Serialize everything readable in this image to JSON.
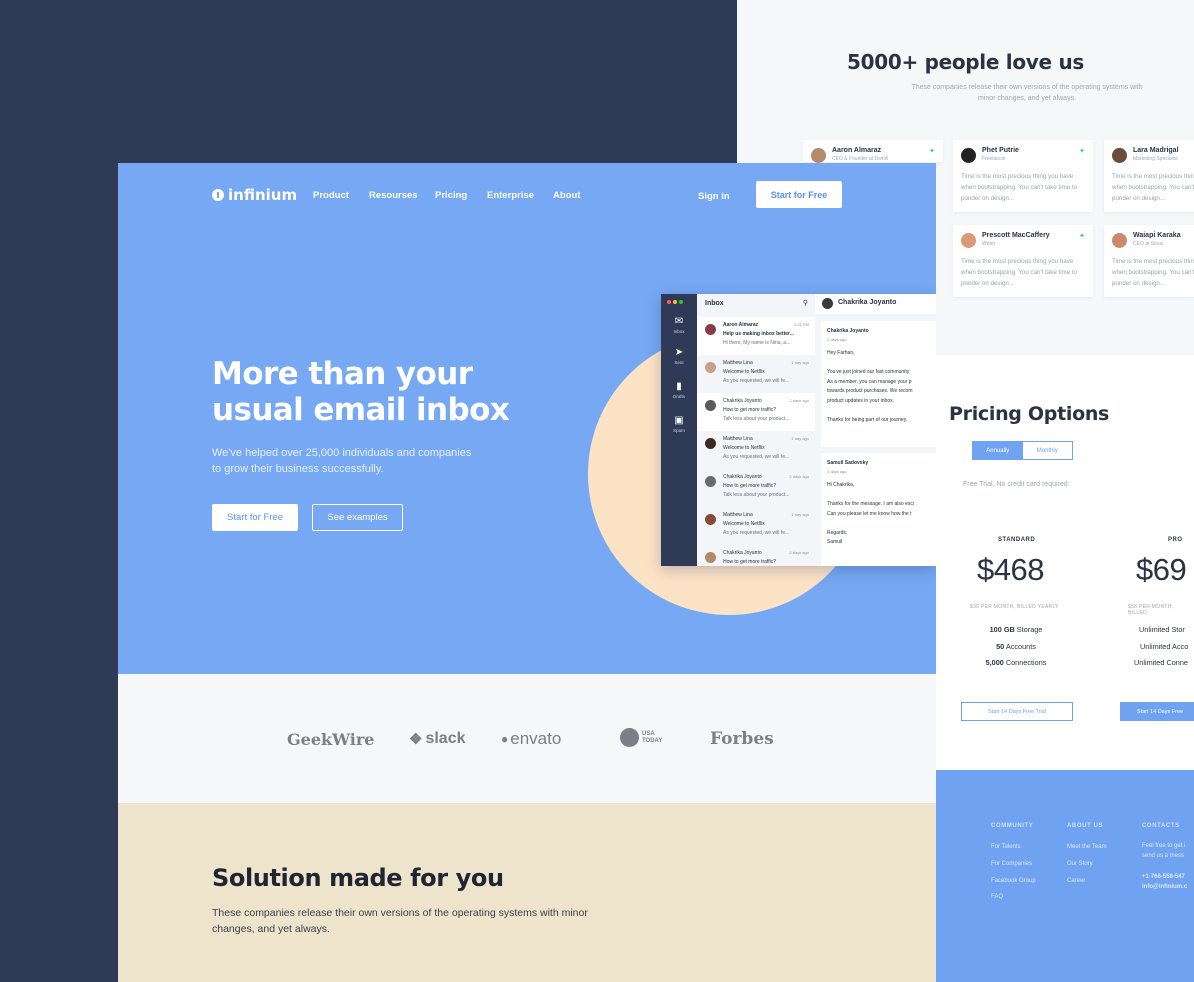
{
  "testimonials": {
    "title": "5000+ people love us",
    "subtitle": "These companies release their own versions of the operating systems with minor changes, and yet always.",
    "cards": [
      {
        "name": "Aaron Almaraz",
        "role": "CEO & Founder at Dwroll",
        "text": ""
      },
      {
        "name": "Phet Putrie",
        "role": "Freelancer",
        "text": "Time is the most precious thing you have when bootstrapping. You can't take time to ponder on design..."
      },
      {
        "name": "Lara Madrigal",
        "role": "Marketing Specialist",
        "text": "Time is the most precious thing you have when bootstrapping. You can't take time to ponder on design..."
      },
      {
        "name": "Prescott MacCaffery",
        "role": "Writer",
        "text": "Time is the most precious thing you have when bootstrapping. You can't take time to ponder on design..."
      },
      {
        "name": "Waiapi Karaka",
        "role": "CEO at Sinus",
        "text": "Time is the most precious thing you have when bootstrapping. You can't take time to ponder on design..."
      }
    ]
  },
  "pricing": {
    "title": "Pricing Options",
    "toggle": {
      "annually": "Annually",
      "monthly": "Monthly"
    },
    "note": "Free Trial. No credit card required.",
    "plans": [
      {
        "name": "STANDARD",
        "price": "$468",
        "billing": "$39 PER MONTH, BILLED YEARLY",
        "features": [
          {
            "b": "100 GB",
            "t": " Storage"
          },
          {
            "b": "50",
            "t": " Accounts"
          },
          {
            "b": "5,000",
            "t": " Connections"
          }
        ],
        "cta": "Start 14 Days Free Trial"
      },
      {
        "name": "PRO",
        "price": "$69",
        "billing": "$58 PER MONTH, BILLED",
        "features": [
          {
            "b": "",
            "t": "Unlimited Stor"
          },
          {
            "b": "",
            "t": "Unlimited Acco"
          },
          {
            "b": "",
            "t": "Unlimited Conne"
          }
        ],
        "cta": "Start 14 Days Free"
      }
    ]
  },
  "footer": {
    "community": {
      "heading": "COMMUNITY",
      "links": [
        "For Talents",
        "For Companies",
        "Facebook Group",
        "FAQ"
      ]
    },
    "about": {
      "heading": "ABOUT US",
      "links": [
        "Meet the Team",
        "Our Story",
        "Career"
      ]
    },
    "contacts": {
      "heading": "CONTACTS",
      "lines": [
        "Feel free to get i",
        "send us a mess",
        "+1-766-558-547",
        "info@infinium.c"
      ]
    }
  },
  "landing": {
    "logo": "infinium",
    "nav": [
      "Product",
      "Resourses",
      "Pricing",
      "Enterprise",
      "About"
    ],
    "signin": "Sign in",
    "cta_top": "Start for Free",
    "headline": "More than your usual email inbox",
    "subtext": "We've helped over 25,000 individuals and companies to grow their business successfully.",
    "cta_primary": "Start for Free",
    "cta_secondary": "See examples"
  },
  "mockup": {
    "sidebar": [
      "Inbox",
      "Sent",
      "Drafts",
      "Spam"
    ],
    "list_title": "Inbox",
    "messages": [
      {
        "from": "Aaron Almaraz",
        "time": "2:42 PM",
        "subject": "Help us making inbox better...",
        "preview": "Hi there, My name is Nina, a..."
      },
      {
        "from": "Matthew Lina",
        "time": "1 day ago",
        "subject": "Welcome to Netflix",
        "preview": "As you requested, we will fe..."
      },
      {
        "from": "Chakrika Joyanto",
        "time": "2 days ago",
        "subject": "How to get more traffic?",
        "preview": "Talk less about your product..."
      },
      {
        "from": "Matthew Lina",
        "time": "1 day ago",
        "subject": "Welcome to Netflix",
        "preview": "As you requested, we will fe..."
      },
      {
        "from": "Chakrika Joyanto",
        "time": "2 days ago",
        "subject": "How to get more traffic?",
        "preview": "Talk less about your product..."
      },
      {
        "from": "Matthew Lina",
        "time": "1 day ago",
        "subject": "Welcome to Netflix",
        "preview": "As you requested, we will fe..."
      },
      {
        "from": "Chakrika Joyanto",
        "time": "2 days ago",
        "subject": "How to get more traffic?",
        "preview": ""
      }
    ],
    "reader_name": "Chakrika Joyanto",
    "thread": [
      {
        "from": "Chakrika Joyanto",
        "date": "2 days ago",
        "body": "Hey Farhan,\n\nYou've just joined our fast community\nAs a member, you can manage your p\ntowards product purchases. We recom\nproduct updates in your inbox.\n\nThanks for being part of our journey."
      },
      {
        "from": "Samuil Sadovsky",
        "date": "2 days ago",
        "body": "Hi Chakrika,\n\nThanks for the message. I am also exci\nCan you please let me know how the t\n\nRegards,\nSamuil"
      }
    ]
  },
  "brands": [
    "GeekWire",
    "slack",
    "envato",
    "USA TODAY",
    "Forbes"
  ],
  "solution": {
    "title": "Solution made for you",
    "subtitle": "These companies release their own versions of the operating systems with minor changes, and yet always."
  },
  "colors": {
    "hero": "#76a8f3",
    "navy": "#2f3a56",
    "accent": "#6fa2f0",
    "peach": "#fde3c6",
    "sand": "#ede4cb"
  }
}
